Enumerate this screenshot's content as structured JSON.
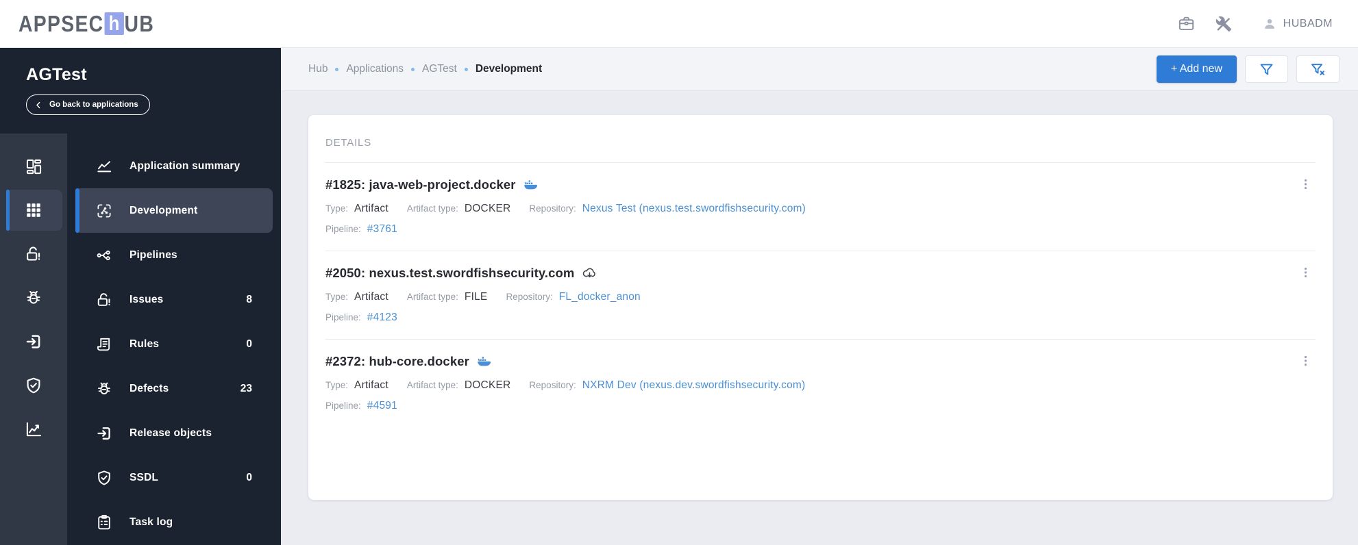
{
  "colors": {
    "accent_blue": "#2e7cd6",
    "link_blue": "#4a8fd2",
    "sidebar_bg": "#1c2330",
    "rail_bg": "#313845",
    "selected_item_bg": "#3d4557",
    "page_bg": "#ebecf2",
    "logo_badge": "#96a5e9",
    "docker_icon_blue": "#4a8ed6"
  },
  "header": {
    "logo_pre": "APPSEC",
    "logo_mid": "h",
    "logo_post": "UB",
    "username": "HUBADM",
    "icons": [
      "briefcase-icon",
      "tools-icon",
      "user-icon"
    ]
  },
  "sidebar": {
    "app_name": "AGTest",
    "back_label": "Go back to applications",
    "rail": [
      {
        "icon": "dashboard-icon",
        "selected": false
      },
      {
        "icon": "apps-grid-icon",
        "selected": true
      },
      {
        "icon": "lock-open-alert-icon",
        "selected": false
      },
      {
        "icon": "bug-icon",
        "selected": false
      },
      {
        "icon": "enter-icon",
        "selected": false
      },
      {
        "icon": "shield-check-icon",
        "selected": false
      },
      {
        "icon": "chart-icon",
        "selected": false
      }
    ],
    "menu": [
      {
        "label": "Application summary",
        "icon": "line-chart-icon",
        "count": "",
        "selected": false
      },
      {
        "label": "Development",
        "icon": "dev-branch-icon",
        "count": "",
        "selected": true
      },
      {
        "label": "Pipelines",
        "icon": "pipeline-fork-icon",
        "count": "",
        "selected": false
      },
      {
        "label": "Issues",
        "icon": "lock-open-alert-icon",
        "count": "8",
        "selected": false
      },
      {
        "label": "Rules",
        "icon": "scroll-icon",
        "count": "0",
        "selected": false
      },
      {
        "label": "Defects",
        "icon": "bug-icon",
        "count": "23",
        "selected": false
      },
      {
        "label": "Release objects",
        "icon": "enter-icon",
        "count": "",
        "selected": false
      },
      {
        "label": "SSDL",
        "icon": "shield-check-icon",
        "count": "0",
        "selected": false
      },
      {
        "label": "Task log",
        "icon": "clipboard-icon",
        "count": "",
        "selected": false
      }
    ]
  },
  "breadcrumb": {
    "items": [
      "Hub",
      "Applications",
      "AGTest",
      "Development"
    ]
  },
  "toolbar": {
    "add_new_label": "+ Add new",
    "icons": [
      "filter-icon",
      "filter-clear-icon"
    ]
  },
  "main": {
    "heading": "DETAILS",
    "labels": {
      "type": "Type:",
      "artifact_type": "Artifact type:",
      "repository": "Repository:",
      "pipeline": "Pipeline:"
    },
    "cards": [
      {
        "title": "#1825: java-web-project.docker",
        "icon": "docker-whale-icon",
        "type": "Artifact",
        "artifact_type": "DOCKER",
        "repository": "Nexus Test (nexus.test.swordfishsecurity.com)",
        "pipeline": "#3761"
      },
      {
        "title": "#2050: nexus.test.swordfishsecurity.com",
        "icon": "cloud-download-icon",
        "type": "Artifact",
        "artifact_type": "FILE",
        "repository": "FL_docker_anon",
        "pipeline": "#4123"
      },
      {
        "title": "#2372: hub-core.docker",
        "icon": "docker-whale-icon",
        "type": "Artifact",
        "artifact_type": "DOCKER",
        "repository": "NXRM Dev (nexus.dev.swordfishsecurity.com)",
        "pipeline": "#4591"
      }
    ]
  }
}
